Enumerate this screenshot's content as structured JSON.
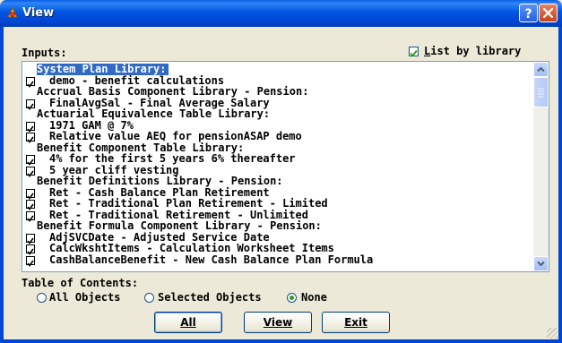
{
  "window": {
    "title": "View"
  },
  "inputs_label": "Inputs:",
  "list_by_library": {
    "prefix": "",
    "underlined": "L",
    "rest": "ist by library",
    "checked": true
  },
  "items": [
    {
      "text": "System Plan Library:",
      "header": true,
      "selected": true
    },
    {
      "text": "demo - benefit calculations",
      "checked": true
    },
    {
      "text": "Accrual Basis Component Library - Pension:",
      "header": true
    },
    {
      "text": "FinalAvgSal - Final Average Salary",
      "checked": true
    },
    {
      "text": "Actuarial Equivalence Table Library:",
      "header": true
    },
    {
      "text": "1971 GAM @ 7%",
      "checked": true
    },
    {
      "text": "Relative value AEQ for pensionASAP demo",
      "checked": true
    },
    {
      "text": "Benefit Component Table Library:",
      "header": true
    },
    {
      "text": "4% for the first 5 years 6% thereafter",
      "checked": true
    },
    {
      "text": "5 year cliff vesting",
      "checked": true
    },
    {
      "text": "Benefit Definitions Library - Pension:",
      "header": true
    },
    {
      "text": "Ret - Cash Balance Plan Retirement",
      "checked": true
    },
    {
      "text": "Ret - Traditional Plan Retirement - Limited",
      "checked": true
    },
    {
      "text": "Ret - Traditional Retirement - Unlimited",
      "checked": true
    },
    {
      "text": "Benefit Formula Component Library - Pension:",
      "header": true
    },
    {
      "text": "AdjSVCDate - Adjusted Service Date",
      "checked": true
    },
    {
      "text": "CalcWkshtItems - Calculation Worksheet Items",
      "checked": true
    },
    {
      "text": "CashBalanceBenefit - New Cash Balance Plan Formula",
      "checked": true
    }
  ],
  "toc": {
    "label": "Table of Contents:",
    "options": [
      {
        "label": "All Objects",
        "selected": false
      },
      {
        "label": "Selected Objects",
        "selected": false
      },
      {
        "label": "None",
        "selected": true
      }
    ]
  },
  "buttons": {
    "all": "All",
    "view": "View",
    "exit": "Exit"
  },
  "icons": {
    "title": "app-icon",
    "help": "help-icon",
    "close": "close-icon",
    "scroll_up": "scroll-up-arrow-icon",
    "scroll_down": "scroll-down-arrow-icon"
  }
}
